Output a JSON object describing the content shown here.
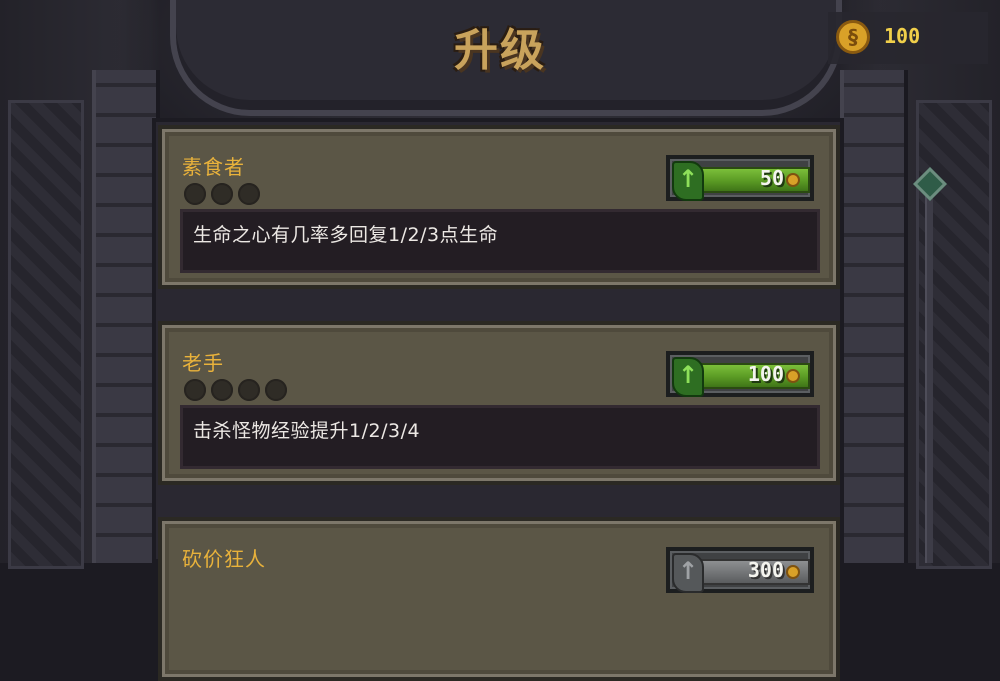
{
  "title": "升级",
  "coins": {
    "value": "100",
    "icon": "coin-icon"
  },
  "upgrades": [
    {
      "name": "素食者",
      "levels_total": 3,
      "levels_owned": 0,
      "description": "生命之心有几率多回复1/2/3点生命",
      "price": "50",
      "affordable": true
    },
    {
      "name": "老手",
      "levels_total": 4,
      "levels_owned": 0,
      "description": "击杀怪物经验提升1/2/3/4",
      "price": "100",
      "affordable": true
    },
    {
      "name": "砍价狂人",
      "levels_total": 0,
      "levels_owned": 0,
      "description": "",
      "price": "300",
      "affordable": false
    }
  ],
  "colors": {
    "accent_gold": "#e9b23b",
    "buy_green": "#5a9a24",
    "disabled_gray": "#6f7173"
  }
}
